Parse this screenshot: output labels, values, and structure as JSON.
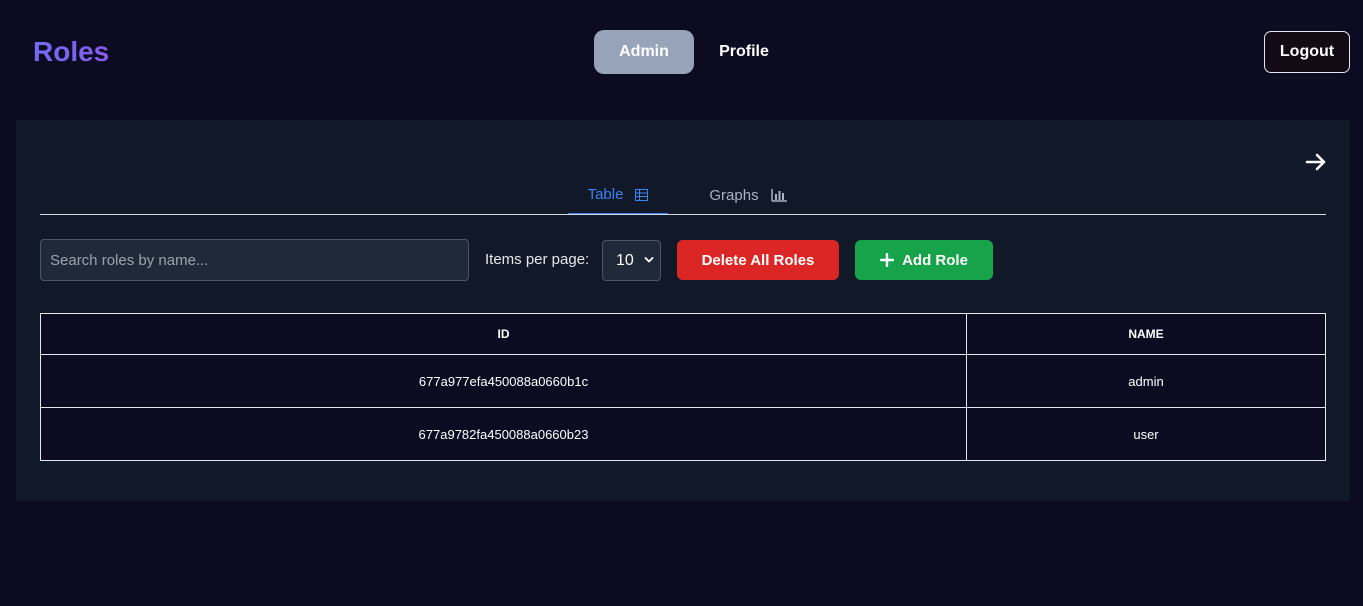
{
  "header": {
    "brand": "Roles",
    "nav": [
      {
        "label": "Admin",
        "active": true
      },
      {
        "label": "Profile",
        "active": false
      }
    ],
    "logout_label": "Logout"
  },
  "tabs": [
    {
      "label": "Table",
      "icon": "table-icon",
      "active": true
    },
    {
      "label": "Graphs",
      "icon": "bar-chart-icon",
      "active": false
    }
  ],
  "toolbar": {
    "search_placeholder": "Search roles by name...",
    "items_per_page_label": "Items per page:",
    "items_per_page_value": "10",
    "delete_all_label": "Delete All Roles",
    "add_role_label": "Add Role"
  },
  "table": {
    "columns": [
      "ID",
      "NAME"
    ],
    "rows": [
      {
        "id": "677a977efa450088a0660b1c",
        "name": "admin"
      },
      {
        "id": "677a9782fa450088a0660b23",
        "name": "user"
      }
    ]
  },
  "colors": {
    "background": "#0d0b22",
    "panel": "#111827",
    "active_tab": "#3b82f6",
    "delete": "#dc2626",
    "add": "#16a34a",
    "admin_nav": "#97a3b8"
  }
}
